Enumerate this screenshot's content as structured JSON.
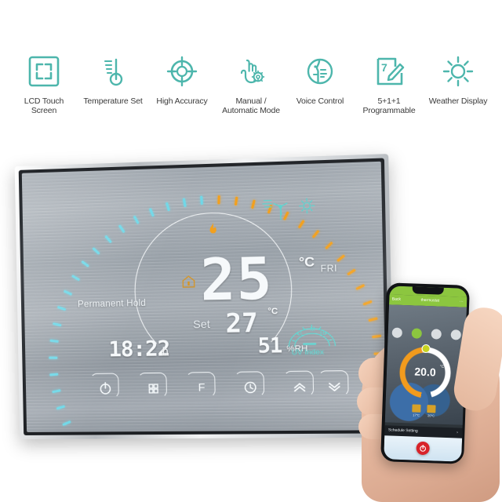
{
  "features": [
    {
      "id": "lcd-touch-screen",
      "icon": "screen-frame-icon",
      "label": "LCD Touch Screen"
    },
    {
      "id": "temperature-set",
      "icon": "thermometer-icon",
      "label": "Temperature Set"
    },
    {
      "id": "high-accuracy",
      "icon": "target-crosshair-icon",
      "label": "High Accuracy"
    },
    {
      "id": "manual-automatic-mode",
      "icon": "hand-gear-icon",
      "label": "Manual /\nAutomatic Mode"
    },
    {
      "id": "voice-control",
      "icon": "voice-face-icon",
      "label": "Voice Control"
    },
    {
      "id": "programmable",
      "icon": "calendar-pencil-icon",
      "label": "5+1+1\nProgrammable"
    },
    {
      "id": "weather-display",
      "icon": "sun-icon",
      "label": "Weather Display"
    }
  ],
  "colors": {
    "feature_teal": "#4db6ac",
    "lcd_cool": "#6fd8e8",
    "lcd_warm": "#f2a01e",
    "lcd_text": "#f6f9fb",
    "uv_teal": "#5fd3cf",
    "app_green": "#8cc63f",
    "app_orange": "#f29b1d",
    "power_red": "#d8232a"
  },
  "thermostat": {
    "current_temp": "25",
    "current_unit": "°C",
    "set_label": "Set",
    "set_temp": "27",
    "set_unit": "°C",
    "clock": "18:22",
    "clock_unit": "h",
    "humidity": "51",
    "humidity_unit": "%RH",
    "hold_status": "Permanent Hold",
    "weekday": "FRI",
    "uv_label": "UV Index",
    "uv_scale": [
      "L",
      "M",
      "H"
    ],
    "indicators": {
      "flame": "flame-icon",
      "house": "house-icon",
      "wind": "windmill-icon",
      "sun": "sun-icon"
    },
    "dial": {
      "cool_ticks": 21,
      "warm_ticks": 21
    },
    "buttons": [
      {
        "id": "power",
        "icon": "power-icon"
      },
      {
        "id": "menu",
        "icon": "grid-menu-icon"
      },
      {
        "id": "unit",
        "icon": "fahrenheit-icon",
        "label": "F"
      },
      {
        "id": "clock",
        "icon": "clock-icon"
      },
      {
        "id": "up",
        "icon": "chevron-up-icon"
      },
      {
        "id": "down",
        "icon": "chevron-down-icon"
      }
    ]
  },
  "phone_app": {
    "back_label": "Back",
    "title": "thermostat",
    "more_label": "···",
    "temperature": "20.0",
    "temperature_unit": "°C",
    "mode_buttons": [
      "manual-mode-icon",
      "auto-mode-icon",
      "eco-mode-icon",
      "lock-icon"
    ],
    "mini_stats": [
      {
        "icon": "thermometer-icon",
        "value": "17°C"
      },
      {
        "icon": "heater-icon",
        "value": "20°C"
      }
    ],
    "schedule_label": "Schedule Setting",
    "schedule_chevron": "›",
    "power_icon": "power-icon"
  }
}
